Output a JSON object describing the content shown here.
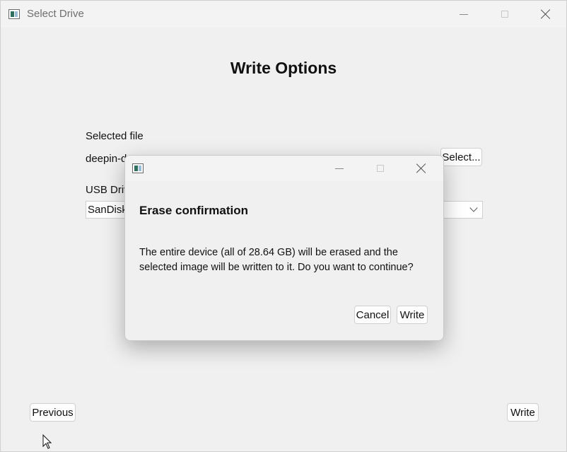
{
  "window": {
    "title": "Select Drive",
    "icon": "app-window-icon"
  },
  "page": {
    "heading": "Write Options",
    "selected_file_label": "Selected file",
    "selected_file_value": "deepin-d",
    "select_button": "Select...",
    "usb_drive_label": "USB Driv",
    "usb_drive_value": "SanDisk",
    "previous_button": "Previous",
    "write_button": "Write"
  },
  "dialog": {
    "title": "Erase confirmation",
    "message_line1": "The entire device (all of 28.64 GB) will be erased and the",
    "message_line2": "selected image will be written to it. Do you want to continue?",
    "cancel_button": "Cancel",
    "write_button": "Write"
  },
  "colors": {
    "window_bg": "#f0f0f0",
    "titlebar_bg": "#f3f3f3",
    "text": "#111111"
  }
}
